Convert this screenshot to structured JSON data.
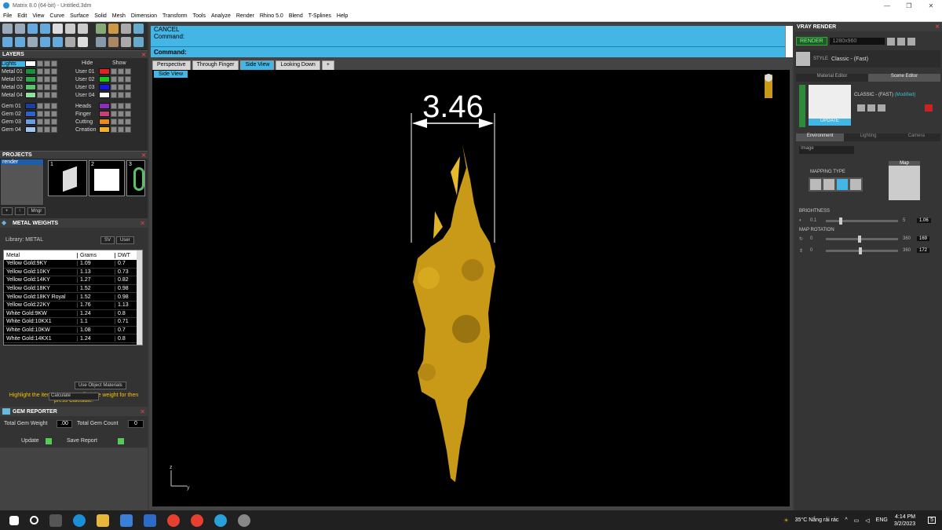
{
  "window": {
    "title": "Matrix 8.0 (64-bit) - Untitled.3dm",
    "minimize": "—",
    "maximize": "❐",
    "close": "✕"
  },
  "menu": [
    "File",
    "Edit",
    "View",
    "Curve",
    "Surface",
    "Solid",
    "Mesh",
    "Dimension",
    "Transform",
    "Tools",
    "Analyze",
    "Render",
    "Rhino 5.0",
    "Blend",
    "T-Splines",
    "Help"
  ],
  "layers": {
    "title": "LAYERS",
    "hide": "Hide",
    "show": "Show",
    "left": [
      {
        "name": "Lights",
        "color": "#ffffff"
      },
      {
        "name": "Metal 01",
        "color": "#1a8f3e"
      },
      {
        "name": "Metal 02",
        "color": "#2fa84f"
      },
      {
        "name": "Metal 03",
        "color": "#59c46b"
      },
      {
        "name": "Metal 04",
        "color": "#8fe09a"
      },
      {
        "name": "Gem 01",
        "color": "#1a3fa0"
      },
      {
        "name": "Gem 02",
        "color": "#2e62c8"
      },
      {
        "name": "Gem 03",
        "color": "#6b9be0"
      },
      {
        "name": "Gem 04",
        "color": "#a3c6f0"
      }
    ],
    "right": [
      {
        "name": "User 01",
        "color": "#e52020"
      },
      {
        "name": "User 02",
        "color": "#1cc41c"
      },
      {
        "name": "User 03",
        "color": "#1818e0"
      },
      {
        "name": "User 04",
        "color": "#ffffff"
      },
      {
        "name": "Heads",
        "color": "#8a2fb8"
      },
      {
        "name": "Finger",
        "color": "#c8407a"
      },
      {
        "name": "Cutting",
        "color": "#e88a20"
      },
      {
        "name": "Creation",
        "color": "#f0b02a"
      }
    ]
  },
  "projects": {
    "title": "PROJECTS",
    "item": "render",
    "thumbs": [
      "1",
      "2",
      "3"
    ],
    "mngr": "Mngr"
  },
  "metal_weights": {
    "title": "METAL WEIGHTS",
    "library": "Library: METAL",
    "sv": "SV",
    "user": "User",
    "columns": [
      "Metal",
      "Grams",
      "DWT"
    ],
    "rows": [
      [
        "Yellow Gold:9KY",
        "1.09",
        "0.7"
      ],
      [
        "Yellow Gold:10KY",
        "1.13",
        "0.73"
      ],
      [
        "Yellow Gold:14KY",
        "1.27",
        "0.82"
      ],
      [
        "Yellow Gold:18KY",
        "1.52",
        "0.98"
      ],
      [
        "Yellow Gold:18KY Royal",
        "1.52",
        "0.98"
      ],
      [
        "Yellow Gold:22KY",
        "1.76",
        "1.13"
      ],
      [
        "White Gold:9KW",
        "1.24",
        "0.8"
      ],
      [
        "White Gold:10KX1",
        "1.1",
        "0.71"
      ],
      [
        "White Gold:10KW",
        "1.08",
        "0.7"
      ],
      [
        "White Gold:14KX1",
        "1.24",
        "0.8"
      ]
    ],
    "use_object": "Use Object Materials",
    "hint": "Highlight the item you want to find the weight for then press Calculate.",
    "calculate": "Calculate"
  },
  "gem_reporter": {
    "title": "GEM REPORTER",
    "total_weight_label": "Total Gem Weight",
    "total_weight": ".00",
    "total_count_label": "Total Gem Count",
    "total_count": "0",
    "update": "Update",
    "save": "Save Report"
  },
  "command": {
    "line1": "CANCEL",
    "line2": "Command:",
    "prompt": "Command:"
  },
  "tabs": [
    "Perspective",
    "Through Finger",
    "Side View",
    "Looking Down"
  ],
  "active_tab": "Side View",
  "viewport": {
    "label": "Side View",
    "dimension": "3.46",
    "axis_z": "z",
    "axis_y": "y"
  },
  "vray": {
    "title": "VRAY RENDER",
    "render": "RENDER",
    "resolution": "1280x960",
    "style_label": "STYLE",
    "style": "Classic - (Fast)",
    "tab_material": "Material Editor",
    "tab_scene": "Scene Editor",
    "preset": "CLASSIC - (FAST)",
    "modified": "(Modified)",
    "update": "UPDATE",
    "env_tabs": [
      "Environment",
      "Lighting",
      "Camera"
    ],
    "env_type": "Image",
    "mapping_type": "MAPPING TYPE",
    "map": "Map",
    "brightness_label": "BRIGHTNESS",
    "brightness_min": "0.1",
    "brightness_max": "5",
    "brightness": "1.06",
    "map_rotation_label": "MAP ROTATION",
    "rot1_min": "0",
    "rot1_max": "360",
    "rot1": "169",
    "rot2_min": "0",
    "rot2_max": "360",
    "rot2": "172"
  },
  "taskbar": {
    "weather": "35°C  Nắng rải rác",
    "lang": "ENG",
    "time": "4:14 PM",
    "date": "3/2/2023",
    "notif": "5"
  }
}
